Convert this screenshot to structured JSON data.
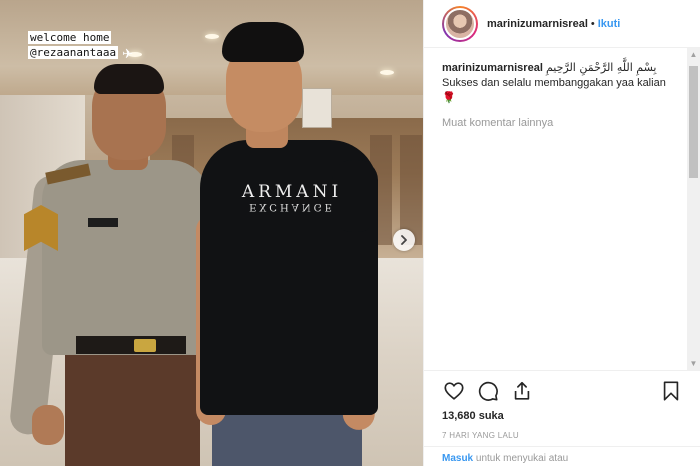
{
  "overlay": {
    "line1": "welcome home",
    "line2": "@rezaanantaaa"
  },
  "photo": {
    "shirt_brand": "ARMANI",
    "shirt_sub": "EXCHANGE"
  },
  "header": {
    "username": "marinizumarnisreal",
    "separator": "•",
    "follow_label": "Ikuti"
  },
  "caption": {
    "username": "marinizumarnisreal",
    "arabic": "بِسْمِ اللَّهِ الرَّحْمَنِ الرَّحِيمِ",
    "text": "Sukses dan selalu membanggakan yaa kalian",
    "emoji": "🌹"
  },
  "comments": {
    "load_more": "Muat komentar lainnya"
  },
  "actions": {
    "likes": "13,680 suka",
    "time": "7 HARI YANG LALU"
  },
  "login": {
    "link": "Masuk",
    "text": "untuk menyukai atau"
  },
  "icons": {
    "like": "heart-icon",
    "comment": "comment-icon",
    "share": "share-icon",
    "save": "bookmark-icon",
    "next": "chevron-right-icon"
  },
  "colors": {
    "accent": "#3897f0",
    "muted": "#999999",
    "text": "#262626"
  }
}
